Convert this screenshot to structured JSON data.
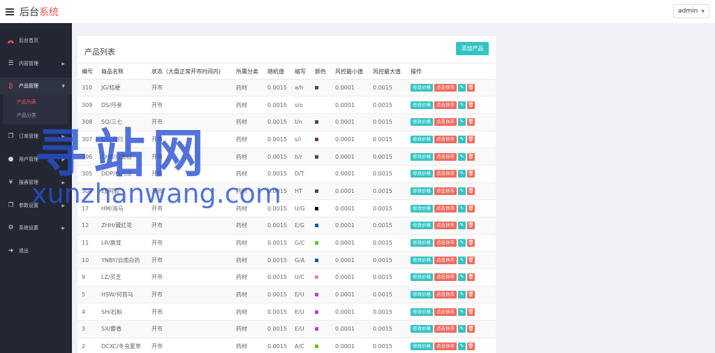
{
  "header": {
    "logo_main": "后台",
    "logo_accent": "系统",
    "user": "admin"
  },
  "sidebar": {
    "items": [
      {
        "label": "后台首页",
        "icon": "dashboard-icon"
      },
      {
        "label": "内容管理",
        "icon": "list-icon"
      },
      {
        "label": "产品管理",
        "icon": "bitcoin-icon"
      },
      {
        "label": "订单管理",
        "icon": "copy-icon"
      },
      {
        "label": "用户管理",
        "icon": "user-icon"
      },
      {
        "label": "报表管理",
        "icon": "yen-icon"
      },
      {
        "label": "参数设置",
        "icon": "copy-icon"
      },
      {
        "label": "系统设置",
        "icon": "gears-icon"
      },
      {
        "label": "退出",
        "icon": "sign-out-icon"
      }
    ],
    "sub_items": [
      {
        "label": "产品列表"
      },
      {
        "label": "产品分类"
      }
    ]
  },
  "panel": {
    "title": "产品列表",
    "add_button": "添加产品"
  },
  "table": {
    "headers": [
      "编号",
      "商品名称",
      "状态（大盘正常开市时间内)",
      "所属分类",
      "随机值",
      "缩写",
      "颜色",
      "风控最小值",
      "风控最大值",
      "操作"
    ],
    "actions": {
      "edit_price": "修改价格",
      "stop": "点击休市"
    },
    "rows": [
      {
        "id": "310",
        "name": "JG/桔梗",
        "status": "开市",
        "category": "药材",
        "random": "0.0015",
        "abbr": "a/h",
        "color": "#6b3d3d",
        "min": "0.0001",
        "max": "0.0015"
      },
      {
        "id": "309",
        "name": "DS/丹参",
        "status": "开市",
        "category": "药材",
        "random": "0.0015",
        "abbr": "s/o",
        "color": "",
        "min": "0.0001",
        "max": "0.0015"
      },
      {
        "id": "308",
        "name": "SQ/三七",
        "status": "开市",
        "category": "药材",
        "random": "0.0015",
        "abbr": "t/n",
        "color": "#6b3d3d",
        "min": "0.0001",
        "max": "0.0015"
      },
      {
        "id": "307",
        "name": "DG/当归",
        "status": "开市",
        "category": "药材",
        "random": "0.0015",
        "abbr": "s/l",
        "color": "#6b3d3d",
        "min": "0.0001",
        "max": "0.0015"
      },
      {
        "id": "306",
        "name": "CHB/川黄柏",
        "status": "开市",
        "category": "药材",
        "random": "0.0015",
        "abbr": "b/r",
        "color": "#6b3d3d",
        "min": "0.0001",
        "max": "0.0015"
      },
      {
        "id": "305",
        "name": "DDP/杜丹皮",
        "status": "开市",
        "category": "药材",
        "random": "0.0015",
        "abbr": "D/T",
        "color": "",
        "min": "0.0001",
        "max": "0.0015"
      },
      {
        "id": "304",
        "name": "EJ/阿胶",
        "status": "开市",
        "category": "药材",
        "random": "0.0015",
        "abbr": "HT",
        "color": "#6b3d3d",
        "min": "0.0001",
        "max": "0.0015"
      },
      {
        "id": "17",
        "name": "HM/海马",
        "status": "开市",
        "category": "药材",
        "random": "0.0015",
        "abbr": "U/G",
        "color": "#111111",
        "min": "0.0001",
        "max": "0.0015"
      },
      {
        "id": "12",
        "name": "ZHH/藏红花",
        "status": "开市",
        "category": "药材",
        "random": "0.0015",
        "abbr": "E/G",
        "color": "#1f4fbf",
        "min": "0.0001",
        "max": "0.0015"
      },
      {
        "id": "11",
        "name": "LR/鹿茸",
        "status": "开市",
        "category": "药材",
        "random": "0.0015",
        "abbr": "G/C",
        "color": "#66c01e",
        "min": "0.0001",
        "max": "0.0015"
      },
      {
        "id": "10",
        "name": "YNBY/云南白药",
        "status": "开市",
        "category": "药材",
        "random": "0.0015",
        "abbr": "G/A",
        "color": "#1f4fbf",
        "min": "0.0001",
        "max": "0.0015"
      },
      {
        "id": "9",
        "name": "LZ/灵芝",
        "status": "开市",
        "category": "药材",
        "random": "0.0015",
        "abbr": "U/C",
        "color": "#f08a80",
        "min": "0.0001",
        "max": "0.0015"
      },
      {
        "id": "5",
        "name": "HSW/何首乌",
        "status": "开市",
        "category": "药材",
        "random": "0.0015",
        "abbr": "E/U",
        "color": "#c23ad6",
        "min": "0.0001",
        "max": "0.0015"
      },
      {
        "id": "4",
        "name": "SH/石斛",
        "status": "开市",
        "category": "药材",
        "random": "0.0015",
        "abbr": "E/U",
        "color": "#c23ad6",
        "min": "0.0001",
        "max": "0.0015"
      },
      {
        "id": "3",
        "name": "SX/麝香",
        "status": "开市",
        "category": "药材",
        "random": "0.0015",
        "abbr": "E/U",
        "color": "#c23ad6",
        "min": "0.0001",
        "max": "0.0015"
      },
      {
        "id": "2",
        "name": "DCXC/冬虫夏草",
        "status": "开市",
        "category": "药材",
        "random": "0.0015",
        "abbr": "A/C",
        "color": "#66c01e",
        "min": "0.0001",
        "max": "0.0015"
      }
    ]
  },
  "watermark": {
    "big": "寻站网",
    "small": "xunzhanwang.com"
  }
}
